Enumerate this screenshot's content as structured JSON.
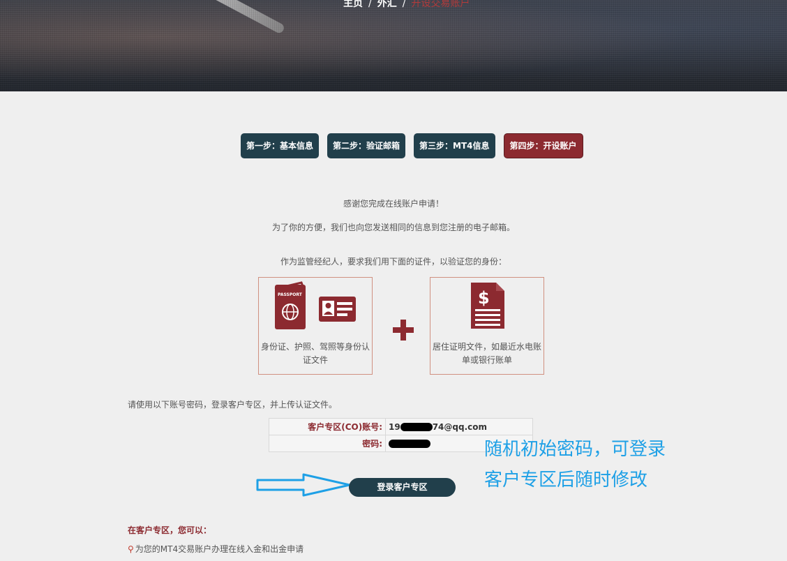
{
  "breadcrumb": {
    "home": "主页",
    "forex": "外汇",
    "current": "开设交易账户"
  },
  "steps": [
    {
      "label": "第一步：基本信息",
      "active": false
    },
    {
      "label": "第二步：验证邮箱",
      "active": false
    },
    {
      "label": "第三步：MT4信息",
      "active": false
    },
    {
      "label": "第四步：开设账户",
      "active": true
    }
  ],
  "messages": {
    "thanks": "感谢您完成在线账户申请！",
    "email_notice": "为了你的方便，我们也向您发送相同的信息到您注册的电子邮箱。",
    "id_requirement": "作为监管经纪人，要求我们用下面的证件，以验证您的身份："
  },
  "documents": {
    "identity": {
      "caption": "身份证、护照、驾照等身份认证文件",
      "passport_label": "PASSPORT"
    },
    "address": {
      "caption": "居住证明文件，如最近水电账单或银行账单"
    }
  },
  "login": {
    "hint": "请使用以下账号密码，登录客户专区，并上传认证文件。",
    "account_label": "客户专区(CO)账号:",
    "account_prefix": "19",
    "account_suffix": "74@qq.com",
    "password_label": "密码:",
    "button": "登录客户专区"
  },
  "annotation": {
    "line1": "随机初始密码，可登录",
    "line2": "客户专区后随时修改"
  },
  "client_area": {
    "title": "在客户专区，您可以：",
    "items": [
      "为您的MT4交易账户办理在线入金和出金申请"
    ]
  },
  "colors": {
    "dark_teal": "#213f4b",
    "maroon": "#8c2a30",
    "annotation_blue": "#1ea0e6"
  }
}
